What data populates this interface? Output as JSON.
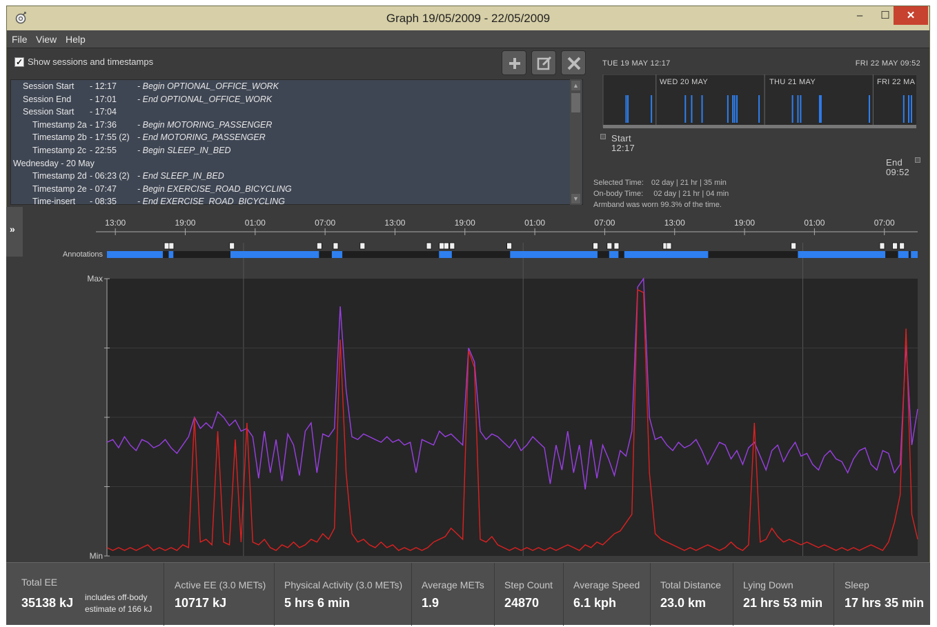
{
  "window": {
    "title": "Graph 19/05/2009 - 22/05/2009",
    "min_glyph": "–",
    "max_glyph": "☐",
    "close_glyph": "✕"
  },
  "menu": [
    "File",
    "View",
    "Help"
  ],
  "toolbar": {
    "show_sessions_label": "Show sessions and timestamps",
    "show_sessions_checked": true,
    "add_icon": "plus-icon",
    "edit_icon": "edit-icon",
    "delete_icon": "close-icon"
  },
  "sessions": [
    {
      "name": "Session Start",
      "time": "- 12:17",
      "desc": "- Begin OPTIONAL_OFFICE_WORK",
      "indent": 1
    },
    {
      "name": "Session End",
      "time": "- 17:01",
      "desc": "- End OPTIONAL_OFFICE_WORK",
      "indent": 1
    },
    {
      "name": "Session Start",
      "time": "- 17:04",
      "desc": "",
      "indent": 1
    },
    {
      "name": "Timestamp 2a",
      "time": "- 17:36",
      "desc": "- Begin MOTORING_PASSENGER",
      "indent": 2
    },
    {
      "name": "Timestamp 2b",
      "time": "- 17:55 (2)",
      "desc": "- End MOTORING_PASSENGER",
      "indent": 2
    },
    {
      "name": "Timestamp 2c",
      "time": "- 22:55",
      "desc": "- Begin SLEEP_IN_BED",
      "indent": 2
    },
    {
      "name": "Wednesday - 20 May",
      "time": "",
      "desc": "",
      "indent": 0
    },
    {
      "name": "Timestamp 2d",
      "time": "- 06:23 (2)",
      "desc": "- End SLEEP_IN_BED",
      "indent": 2
    },
    {
      "name": "Timestamp 2e",
      "time": "- 07:47",
      "desc": "- Begin EXERCISE_ROAD_BICYCLING",
      "indent": 2
    },
    {
      "name": "Time-insert",
      "time": "- 08:35",
      "desc": "- End EXERCISE_ROAD_BICYCLING",
      "indent": 2
    }
  ],
  "overview": {
    "start_header": "TUE 19 MAY 12:17",
    "end_header": "FRI 22 MAY 09:52",
    "days": [
      "WED 20 MAY",
      "THU 21 MAY",
      "FRI 22 MA"
    ],
    "start_label": "Start",
    "start_time": "12:17",
    "end_label": "End",
    "end_time": "09:52",
    "selected_time_label": "Selected Time:",
    "selected_time_value": "02 day | 21 hr | 35 min",
    "onbody_time_label": "On-body Time:",
    "onbody_time_value": "02 day | 21 hr | 04 min",
    "armband_note": "Armband was worn 99.3% of the time."
  },
  "chart_data": {
    "type": "line",
    "x_tick_labels": [
      "13:00",
      "19:00",
      "01:00",
      "07:00",
      "13:00",
      "19:00",
      "01:00",
      "07:00",
      "13:00",
      "19:00",
      "01:00",
      "07:00"
    ],
    "x_ticks_hours": [
      0.72,
      6.72,
      12.72,
      18.72,
      24.72,
      30.72,
      36.72,
      42.72,
      48.72,
      54.72,
      60.72,
      66.72
    ],
    "x_range_hours": [
      0,
      69.58
    ],
    "y_tick_labels": {
      "max": "Max",
      "min": "Min"
    },
    "y_range": [
      0,
      1
    ],
    "annotations_label": "Annotations",
    "annotation_segments_hours": [
      [
        0,
        4.8
      ],
      [
        5.3,
        5.7
      ],
      [
        10.6,
        18.2
      ],
      [
        19.3,
        20.2
      ],
      [
        28.5,
        29.6
      ],
      [
        34.6,
        42.1
      ],
      [
        43.1,
        43.9
      ],
      [
        44.4,
        51.6
      ],
      [
        59.3,
        66.8
      ],
      [
        67.9,
        68.8
      ],
      [
        69.0,
        69.58
      ]
    ],
    "annotation_markers_hours": [
      5.1,
      5.5,
      10.7,
      18.2,
      19.6,
      21.9,
      27.6,
      28.7,
      29.1,
      29.6,
      34.5,
      41.9,
      43.1,
      43.7,
      47.9,
      48.2,
      58.9,
      66.5,
      67.6,
      68.2
    ],
    "series": [
      {
        "color": "#9b3fe6",
        "samples": 140,
        "values": [
          0.41,
          0.42,
          0.39,
          0.43,
          0.4,
          0.38,
          0.42,
          0.41,
          0.39,
          0.4,
          0.42,
          0.39,
          0.37,
          0.4,
          0.43,
          0.5,
          0.46,
          0.48,
          0.46,
          0.52,
          0.5,
          0.47,
          0.49,
          0.45,
          0.46,
          0.43,
          0.28,
          0.45,
          0.3,
          0.42,
          0.27,
          0.44,
          0.4,
          0.29,
          0.45,
          0.48,
          0.3,
          0.44,
          0.43,
          0.46,
          0.9,
          0.6,
          0.43,
          0.42,
          0.44,
          0.43,
          0.42,
          0.41,
          0.43,
          0.41,
          0.42,
          0.4,
          0.41,
          0.3,
          0.42,
          0.41,
          0.4,
          0.45,
          0.43,
          0.44,
          0.42,
          0.4,
          0.75,
          0.7,
          0.45,
          0.42,
          0.44,
          0.43,
          0.41,
          0.39,
          0.42,
          0.38,
          0.4,
          0.43,
          0.41,
          0.39,
          0.26,
          0.4,
          0.31,
          0.45,
          0.3,
          0.4,
          0.24,
          0.42,
          0.28,
          0.4,
          0.35,
          0.29,
          0.38,
          0.36,
          0.45,
          0.97,
          1.0,
          0.5,
          0.42,
          0.43,
          0.4,
          0.38,
          0.41,
          0.39,
          0.4,
          0.42,
          0.38,
          0.33,
          0.37,
          0.41,
          0.4,
          0.35,
          0.38,
          0.33,
          0.39,
          0.41,
          0.36,
          0.31,
          0.38,
          0.4,
          0.34,
          0.38,
          0.41,
          0.36,
          0.37,
          0.33,
          0.31,
          0.36,
          0.38,
          0.35,
          0.34,
          0.3,
          0.35,
          0.38,
          0.39,
          0.33,
          0.31,
          0.38,
          0.37,
          0.3,
          0.33,
          0.76,
          0.4,
          0.53
        ]
      },
      {
        "color": "#e02020",
        "samples": 140,
        "values": [
          0.03,
          0.02,
          0.03,
          0.02,
          0.03,
          0.02,
          0.03,
          0.04,
          0.02,
          0.03,
          0.02,
          0.03,
          0.02,
          0.04,
          0.03,
          0.5,
          0.05,
          0.06,
          0.04,
          0.45,
          0.05,
          0.04,
          0.42,
          0.05,
          0.48,
          0.05,
          0.04,
          0.06,
          0.03,
          0.02,
          0.04,
          0.03,
          0.05,
          0.03,
          0.04,
          0.06,
          0.05,
          0.08,
          0.06,
          0.1,
          0.78,
          0.3,
          0.08,
          0.05,
          0.06,
          0.04,
          0.03,
          0.05,
          0.03,
          0.04,
          0.02,
          0.03,
          0.02,
          0.03,
          0.02,
          0.03,
          0.05,
          0.06,
          0.07,
          0.1,
          0.08,
          0.06,
          0.74,
          0.68,
          0.06,
          0.05,
          0.07,
          0.04,
          0.03,
          0.02,
          0.03,
          0.02,
          0.03,
          0.02,
          0.03,
          0.02,
          0.03,
          0.02,
          0.03,
          0.04,
          0.03,
          0.02,
          0.04,
          0.03,
          0.05,
          0.04,
          0.06,
          0.08,
          0.09,
          0.12,
          0.15,
          0.96,
          0.95,
          0.3,
          0.08,
          0.06,
          0.05,
          0.04,
          0.03,
          0.02,
          0.03,
          0.02,
          0.03,
          0.04,
          0.03,
          0.02,
          0.03,
          0.05,
          0.03,
          0.02,
          0.04,
          0.48,
          0.05,
          0.06,
          0.1,
          0.07,
          0.05,
          0.06,
          0.05,
          0.04,
          0.05,
          0.04,
          0.03,
          0.04,
          0.03,
          0.02,
          0.03,
          0.02,
          0.03,
          0.02,
          0.03,
          0.04,
          0.03,
          0.02,
          0.05,
          0.12,
          0.22,
          0.82,
          0.15,
          0.06
        ]
      }
    ]
  },
  "summary": {
    "total_ee_label": "Total EE",
    "total_ee_value": "35138 kJ",
    "total_ee_note_1": "includes off-body",
    "total_ee_note_2": "estimate of 166 kJ",
    "active_ee_label": "Active EE (3.0 METs)",
    "active_ee_value": "10717 kJ",
    "physical_label": "Physical Activity (3.0 METs)",
    "physical_value": "5 hrs 6 min",
    "mets_label": "Average METs",
    "mets_value": "1.9",
    "steps_label": "Step Count",
    "steps_value": "24870",
    "speed_label": "Average Speed",
    "speed_value": "6.1 kph",
    "distance_label": "Total Distance",
    "distance_value": "23.0 km",
    "lying_label": "Lying Down",
    "lying_value": "21 hrs 53 min",
    "sleep_label": "Sleep",
    "sleep_value": "17 hrs 35 min"
  }
}
